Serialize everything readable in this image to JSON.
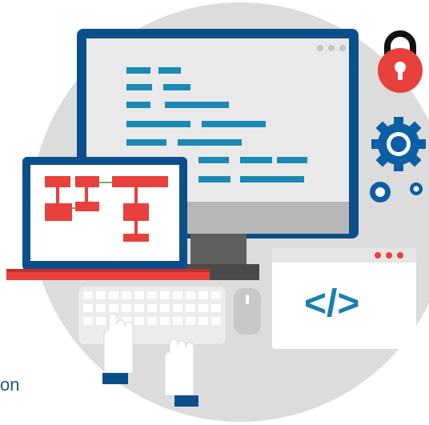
{
  "colors": {
    "circle": "#dcdcdc",
    "navy": "#0b4f8a",
    "screen": "#e9e9e9",
    "code_line": "#1a8ab5",
    "red": "#e8403c",
    "blue_gear": "#0b5fa5",
    "stand": "#5e5e5e",
    "white": "#ffffff"
  },
  "code_snippet": "</>",
  "truncated_text": "on",
  "icons": {
    "lock": "padlock-icon",
    "gear_large": "gear-icon",
    "gear_small": "gear-icon",
    "code_window": "code-window-icon"
  }
}
